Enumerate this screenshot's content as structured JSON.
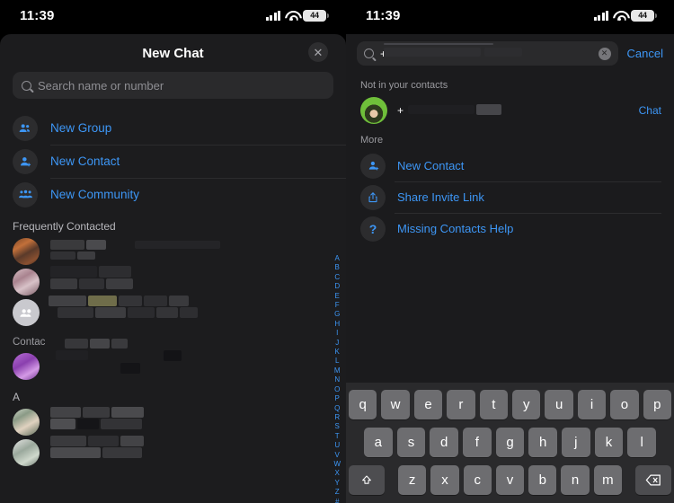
{
  "status_bar": {
    "time": "11:39",
    "battery_percent": "44",
    "signal_icon": "cellular-bars-icon",
    "wifi_icon": "wifi-icon",
    "battery_icon": "battery-icon"
  },
  "left_panel": {
    "title": "New Chat",
    "close_icon": "close-icon",
    "search": {
      "placeholder": "Search name or number",
      "value": "",
      "icon": "search-icon"
    },
    "actions": [
      {
        "label": "New Group",
        "icon": "group-icon"
      },
      {
        "label": "New Contact",
        "icon": "person-add-icon"
      },
      {
        "label": "New Community",
        "icon": "community-icon"
      }
    ],
    "sections": [
      {
        "heading": "Frequently Contacted",
        "rows": [
          {
            "name_redacted": true,
            "avatar": "photo-avatar-warm"
          },
          {
            "name_redacted": true,
            "avatar": "photo-avatar-pink"
          },
          {
            "name_redacted": true,
            "avatar": "group-avatar-placeholder"
          }
        ]
      },
      {
        "heading": "Contac",
        "rows": [
          {
            "name_redacted": true,
            "avatar": "photo-avatar-purple"
          }
        ]
      },
      {
        "heading": "A",
        "rows": [
          {
            "name_redacted": true,
            "avatar": "photo-avatar-green"
          },
          {
            "name_redacted": true,
            "avatar": "photo-avatar-sky"
          }
        ]
      }
    ],
    "alphabet_index": [
      "A",
      "B",
      "C",
      "D",
      "E",
      "F",
      "G",
      "H",
      "I",
      "J",
      "K",
      "L",
      "M",
      "N",
      "O",
      "P",
      "Q",
      "R",
      "S",
      "T",
      "U",
      "V",
      "W",
      "X",
      "Y",
      "Z",
      "#"
    ]
  },
  "right_panel": {
    "search": {
      "value": "+",
      "icon": "search-icon",
      "clear_icon": "clear-icon",
      "cancel_label": "Cancel"
    },
    "not_in_contacts": {
      "heading": "Not in your contacts",
      "row": {
        "name_prefix": "+",
        "name_redacted": true,
        "avatar": "photo-avatar-green-portrait",
        "action_label": "Chat"
      }
    },
    "more": {
      "heading": "More",
      "items": [
        {
          "label": "New Contact",
          "icon": "person-add-icon"
        },
        {
          "label": "Share Invite Link",
          "icon": "share-icon"
        },
        {
          "label": "Missing Contacts Help",
          "icon": "question-icon"
        }
      ]
    }
  },
  "keyboard": {
    "row1": [
      "q",
      "w",
      "e",
      "r",
      "t",
      "y",
      "u",
      "i",
      "o",
      "p"
    ],
    "row2": [
      "a",
      "s",
      "d",
      "f",
      "g",
      "h",
      "j",
      "k",
      "l"
    ],
    "row3": [
      "z",
      "x",
      "c",
      "v",
      "b",
      "n",
      "m"
    ],
    "shift_icon": "shift-icon",
    "delete_icon": "backspace-icon"
  },
  "colors": {
    "accent_blue": "#3d96f5",
    "sheet_bg": "#1c1c1e",
    "key_bg": "#6d6d70",
    "keyboard_bg": "#2a2a2c"
  }
}
